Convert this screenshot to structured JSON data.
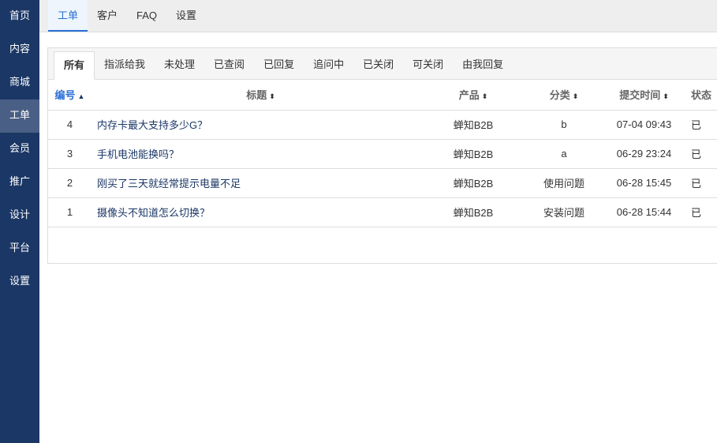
{
  "sidebar": {
    "items": [
      "首页",
      "内容",
      "商城",
      "工单",
      "会员",
      "推广",
      "设计",
      "平台",
      "设置"
    ],
    "active": 3
  },
  "topbar": {
    "tabs": [
      "工单",
      "客户",
      "FAQ",
      "设置"
    ]
  },
  "subtabs": [
    "所有",
    "指派给我",
    "未处理",
    "已查阅",
    "已回复",
    "追问中",
    "已关闭",
    "可关闭",
    "由我回复"
  ],
  "table": {
    "headers": {
      "id": "编号",
      "title": "标题",
      "product": "产品",
      "category": "分类",
      "time": "提交时间",
      "status": "状态"
    },
    "sort_icons": {
      "asc": "▲",
      "both": "⬍"
    },
    "rows": [
      {
        "id": "4",
        "title": "内存卡最大支持多少G？",
        "product": "蝉知B2B",
        "category": "b",
        "time": "07-04 09:43",
        "status": "已"
      },
      {
        "id": "3",
        "title": "手机电池能换吗？",
        "product": "蝉知B2B",
        "category": "a",
        "time": "06-29 23:24",
        "status": "已"
      },
      {
        "id": "2",
        "title": "刚买了三天就经常提示电量不足",
        "product": "蝉知B2B",
        "category": "使用问题",
        "time": "06-28 15:45",
        "status": "已"
      },
      {
        "id": "1",
        "title": "摄像头不知道怎么切换？",
        "product": "蝉知B2B",
        "category": "安装问题",
        "time": "06-28 15:44",
        "status": "已"
      }
    ]
  }
}
